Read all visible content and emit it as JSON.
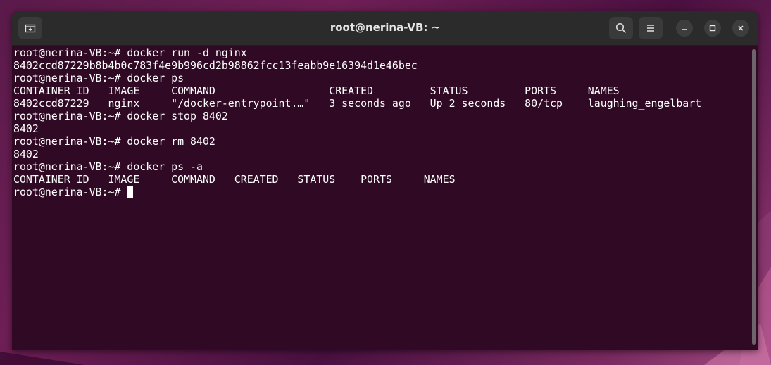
{
  "window": {
    "title": "root@nerina-VB: ~",
    "new_tab_icon": "new-tab-icon",
    "search_icon": "search-icon",
    "menu_icon": "hamburger-menu-icon",
    "minimize_icon": "minimize-icon",
    "maximize_icon": "maximize-icon",
    "close_icon": "close-icon"
  },
  "terminal": {
    "lines": [
      "root@nerina-VB:~# docker run -d nginx",
      "8402ccd87229b8b4b0c783f4e9b996cd2b98862fcc13feabb9e16394d1e46bec",
      "root@nerina-VB:~# docker ps",
      "CONTAINER ID   IMAGE     COMMAND                  CREATED         STATUS         PORTS     NAMES",
      "8402ccd87229   nginx     \"/docker-entrypoint.…\"   3 seconds ago   Up 2 seconds   80/tcp    laughing_engelbart",
      "root@nerina-VB:~# docker stop 8402",
      "8402",
      "root@nerina-VB:~# docker rm 8402",
      "8402",
      "root@nerina-VB:~# docker ps -a",
      "CONTAINER ID   IMAGE     COMMAND   CREATED   STATUS    PORTS     NAMES"
    ],
    "prompt": "root@nerina-VB:~# "
  },
  "colors": {
    "terminal_bg": "#300a24",
    "titlebar_bg": "#2b2b2b",
    "text": "#ffffff"
  }
}
